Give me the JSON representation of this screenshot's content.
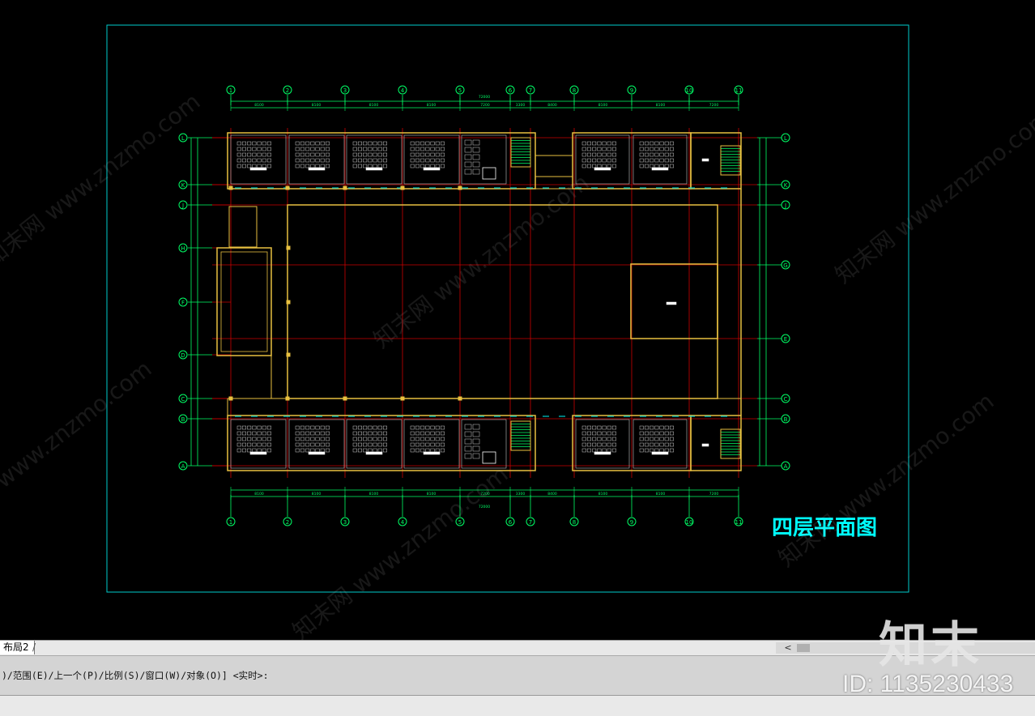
{
  "drawing": {
    "title": "四层平面图",
    "column_axes": [
      "1",
      "2",
      "3",
      "4",
      "5",
      "6",
      "7",
      "8",
      "9",
      "10",
      "11"
    ],
    "row_axes_right": [
      "L",
      "K",
      "J",
      "G",
      "E",
      "C",
      "B",
      "A"
    ],
    "row_axes_left": [
      "L",
      "K",
      "J",
      "H",
      "F",
      "D",
      "C",
      "B",
      "A"
    ],
    "bay_labels_top": [
      "8100",
      "8100",
      "8100",
      "8100",
      "7200",
      "3300",
      "8400",
      "8100",
      "8100",
      "7200"
    ],
    "overall_top": "72000",
    "watermark_text": "知末网 www.znzmo.com"
  },
  "layout_tabs": {
    "active": "布局2",
    "separator": "/"
  },
  "command_line": {
    "text": ")/范围(E)/上一个(P)/比例(S)/窗口(W)/对象(O)] <实时>:"
  },
  "scrollbar": {
    "left_arrow": "<"
  },
  "watermark": {
    "logo": "知末",
    "id": "ID: 1135230433"
  },
  "colors": {
    "frame": "#00cccc",
    "axis": "#00ff66",
    "wall": "#e8c040",
    "red": "#cc0000",
    "title": "#00ffff"
  }
}
